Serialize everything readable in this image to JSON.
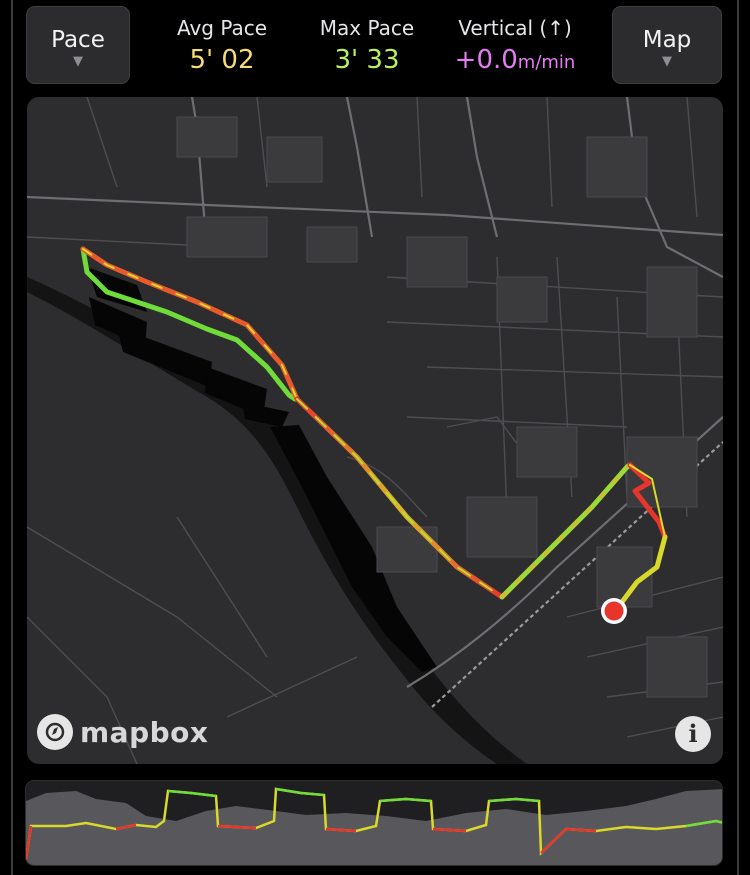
{
  "metric_selector": {
    "label": "Pace",
    "caret": "▼"
  },
  "view_selector": {
    "label": "Map",
    "caret": "▼"
  },
  "stats": {
    "avg_pace": {
      "title": "Avg Pace",
      "value": "5' 02",
      "color": "#f7dc6f"
    },
    "max_pace": {
      "title": "Max Pace",
      "value": "3' 33",
      "color": "#b8f35b"
    },
    "vertical": {
      "title": "Vertical (↑)",
      "value": "+0.0",
      "unit": "m/min",
      "color": "#e37bf2"
    }
  },
  "map": {
    "attribution": "mapbox",
    "info_icon": "info-icon",
    "logo_icon": "mapbox-logo-icon",
    "end_marker_color": "#e8352c",
    "route_colors": {
      "fast": "#6fdc3a",
      "medium": "#d9d92c",
      "slow": "#e8352c"
    }
  },
  "profile_chart": {
    "type": "area",
    "colors": {
      "fast": "#6fdc3a",
      "medium": "#d9d92c",
      "slow": "#e8352c",
      "elevation": "#58585c"
    }
  }
}
